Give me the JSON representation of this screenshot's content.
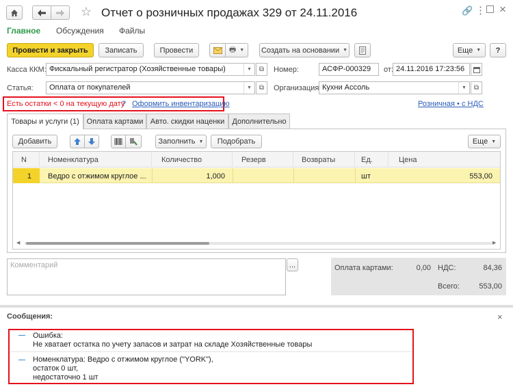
{
  "window": {
    "title": "Отчет о розничных продажах 329 от 24.11.2016"
  },
  "nav": {
    "tabs": [
      "Главное",
      "Обсуждения",
      "Файлы"
    ]
  },
  "toolbar": {
    "post_close": "Провести и закрыть",
    "save": "Записать",
    "post": "Провести",
    "create_based": "Создать на основании",
    "more": "Еще",
    "help": "?"
  },
  "form": {
    "kassa_label": "Касса ККМ:",
    "kassa_value": "Фискальный регистратор (Хозяйственные товары)",
    "number_label": "Номер:",
    "number_value": "АСФР-000329",
    "date_label": "от:",
    "date_value": "24.11.2016 17:23:56",
    "article_label": "Статья:",
    "article_value": "Оплата от покупателей",
    "org_label": "Организация:",
    "org_value": "Кухни Ассоль"
  },
  "warning": {
    "text": "Есть остатки < 0 на текущую дату",
    "q": "?",
    "link": "Оформить инвентаризацию"
  },
  "vat_link": "Розничная • с НДС",
  "tabs": [
    "Товары и услуги (1)",
    "Оплата картами",
    "Авто. скидки наценки",
    "Дополнительно"
  ],
  "grid_toolbar": {
    "add": "Добавить",
    "fill": "Заполнить",
    "pick": "Подобрать",
    "more": "Еще"
  },
  "table": {
    "columns": [
      "N",
      "Номенклатура",
      "Количество",
      "Резерв",
      "Возвраты",
      "Ед.",
      "Цена"
    ],
    "rows": [
      [
        "1",
        "Ведро с отжимом  круглое ...",
        "1,000",
        "",
        "",
        "шт",
        "553,00"
      ]
    ]
  },
  "comment": {
    "placeholder": "Комментарий",
    "btn": "..."
  },
  "totals": {
    "cards_label": "Оплата картами:",
    "cards_value": "0,00",
    "vat_label": "НДС:",
    "vat_value": "84,36",
    "total_label": "Всего:",
    "total_value": "553,00"
  },
  "messages": {
    "title": "Сообщения:",
    "close": "×",
    "items": [
      {
        "lines": [
          "Ошибка:",
          "Не хватает остатка по учету запасов и затрат на складе Хозяйственные товары"
        ]
      },
      {
        "lines": [
          "Номенклатура: Ведро с отжимом  круглое (\"YORK\"),",
          "остаток 0 шт,",
          "недостаточно 1 шт"
        ]
      }
    ]
  },
  "colors": {
    "accent_green": "#2f9a4a",
    "primary_yellow": "#f3d32a",
    "row_highlight": "#fbf3b0",
    "error_red": "#e5101c",
    "link_blue": "#2a5bb8"
  }
}
